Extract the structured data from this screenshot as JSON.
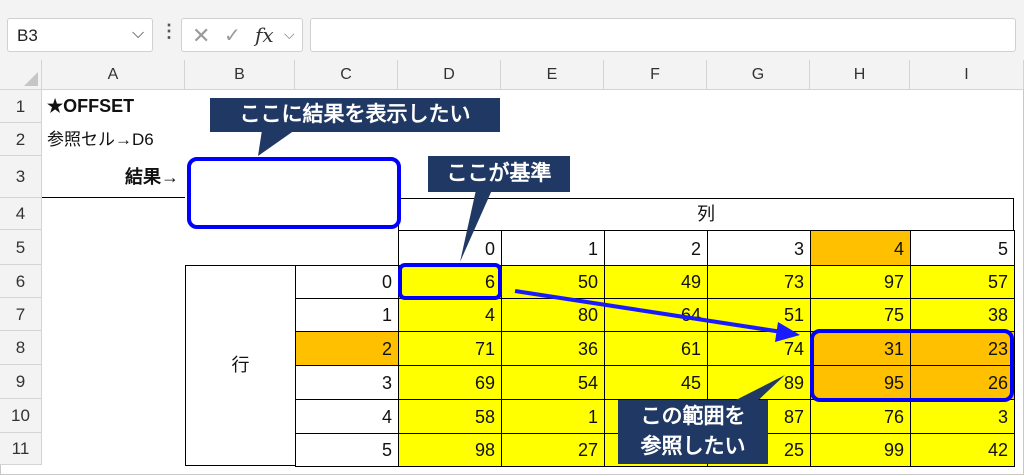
{
  "formula_bar": {
    "name_box": "B3",
    "name_box_dropdown": "⌵",
    "more_icon": "⋮",
    "cancel_icon": "✕",
    "enter_icon": "✓",
    "fx_label": "fx",
    "fx_dropdown": "⌵",
    "formula": ""
  },
  "columns": [
    "A",
    "B",
    "C",
    "D",
    "E",
    "F",
    "G",
    "H",
    "I"
  ],
  "rows": [
    "1",
    "2",
    "3",
    "4",
    "5",
    "6",
    "7",
    "8",
    "9",
    "10",
    "11"
  ],
  "cells": {
    "A1": "★OFFSET",
    "A2": "参照セル→D6",
    "A3": "結果→",
    "B3": "",
    "D4": "列",
    "B6": "行",
    "col_index": [
      "0",
      "1",
      "2",
      "3",
      "4",
      "5"
    ],
    "row_index": [
      "0",
      "1",
      "2",
      "3",
      "4",
      "5"
    ],
    "values": [
      [
        "6",
        "50",
        "49",
        "73",
        "97",
        "57"
      ],
      [
        "4",
        "80",
        "64",
        "51",
        "75",
        "38"
      ],
      [
        "71",
        "36",
        "61",
        "74",
        "31",
        "23"
      ],
      [
        "69",
        "54",
        "45",
        "89",
        "95",
        "26"
      ],
      [
        "58",
        "1",
        "",
        "87",
        "76",
        "3"
      ],
      [
        "98",
        "27",
        "",
        "25",
        "99",
        "42"
      ]
    ]
  },
  "callouts": {
    "result": "ここに結果を表示したい",
    "base": "ここが基準",
    "range_line1": "この範囲を",
    "range_line2": "参照したい"
  },
  "colors": {
    "callout_bg": "#203864",
    "highlight_border": "#0000ff",
    "data_fill": "#ffff00",
    "index_highlight": "#ffc000",
    "arrow": "#1a1aff"
  }
}
